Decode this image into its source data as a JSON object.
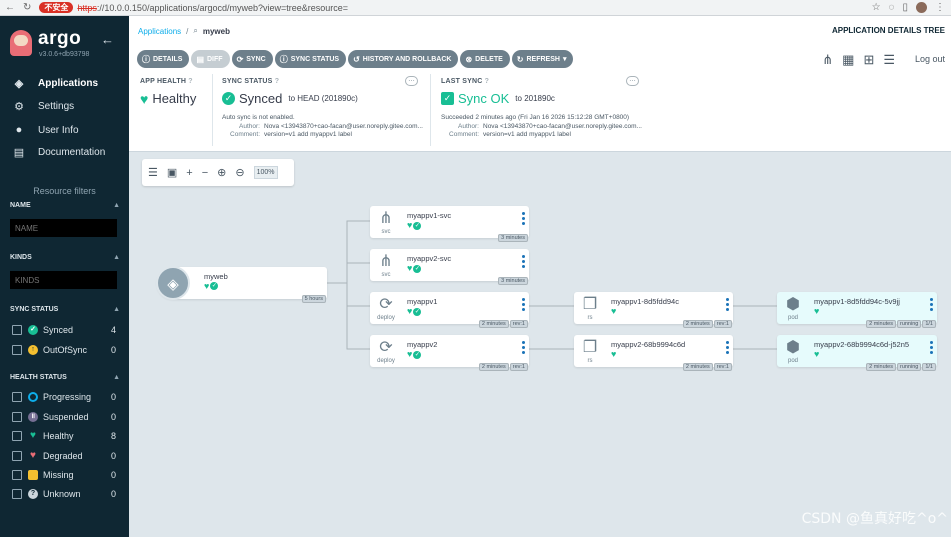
{
  "browser": {
    "insecure_label": "不安全",
    "url_proto": "https",
    "url_rest": "://10.0.0.150/applications/argocd/myweb?view=tree&resource="
  },
  "sidebar": {
    "logo_text": "argo",
    "version": "v3.0.6+db93798",
    "nav": [
      {
        "label": "Applications",
        "icon": "layers-icon"
      },
      {
        "label": "Settings",
        "icon": "gear-icon"
      },
      {
        "label": "User Info",
        "icon": "user-icon"
      },
      {
        "label": "Documentation",
        "icon": "docs-icon"
      }
    ],
    "filters_title": "Resource filters",
    "name_filter": {
      "title": "NAME",
      "placeholder": "NAME"
    },
    "kinds_filter": {
      "title": "KINDS",
      "placeholder": "KINDS"
    },
    "sync_status": {
      "title": "SYNC STATUS",
      "options": [
        {
          "label": "Synced",
          "count": "4",
          "color": "#18be94"
        },
        {
          "label": "OutOfSync",
          "count": "0",
          "color": "#f4c030"
        }
      ]
    },
    "health_status": {
      "title": "HEALTH STATUS",
      "options": [
        {
          "label": "Progressing",
          "count": "0",
          "color": "#0dadea"
        },
        {
          "label": "Suspended",
          "count": "0",
          "color": "#766f94"
        },
        {
          "label": "Healthy",
          "count": "8",
          "color": "#18be94"
        },
        {
          "label": "Degraded",
          "count": "0",
          "color": "#e96d76"
        },
        {
          "label": "Missing",
          "count": "0",
          "color": "#f4c030"
        },
        {
          "label": "Unknown",
          "count": "0",
          "color": "#ccd6dd"
        }
      ]
    }
  },
  "header": {
    "breadcrumb_root": "Applications",
    "breadcrumb_sep": "/",
    "breadcrumb_current": "myweb",
    "page_title": "APPLICATION DETAILS TREE",
    "logout": "Log out",
    "toolbar": [
      {
        "label": "DETAILS",
        "icon": "info-icon",
        "disabled": false
      },
      {
        "label": "DIFF",
        "icon": "diff-icon",
        "disabled": true
      },
      {
        "label": "SYNC",
        "icon": "sync-icon",
        "disabled": false
      },
      {
        "label": "SYNC STATUS",
        "icon": "info-icon",
        "disabled": false
      },
      {
        "label": "HISTORY AND ROLLBACK",
        "icon": "history-icon",
        "disabled": false
      },
      {
        "label": "DELETE",
        "icon": "delete-icon",
        "disabled": false
      },
      {
        "label": "REFRESH",
        "icon": "refresh-icon",
        "disabled": false
      }
    ]
  },
  "app_health": {
    "title": "APP HEALTH",
    "value": "Healthy"
  },
  "sync_status": {
    "title": "SYNC STATUS",
    "value": "Synced",
    "target": "to HEAD (201890c)",
    "note": "Auto sync is not enabled.",
    "author_key": "Author:",
    "author": "Nova <13943870+cao-facan@user.noreply.gitee.com...",
    "comment_key": "Comment:",
    "comment": "version=v1 add myappv1 label"
  },
  "last_sync": {
    "title": "LAST SYNC",
    "value": "Sync OK",
    "target": "to 201890c",
    "note": "Succeeded 2 minutes ago (Fri Jan 16 2026 15:12:28 GMT+0800)",
    "author_key": "Author:",
    "author": "Nova <13943870+cao-facan@user.noreply.gitee.com...",
    "comment_key": "Comment:",
    "comment": "version=v1 add myappv1 label"
  },
  "zoom": {
    "level": "100%"
  },
  "tree": {
    "app": {
      "name": "myweb",
      "age": "5 hours"
    },
    "nodes": [
      {
        "kind": "svc",
        "name": "myappv1-svc",
        "tags": [
          "3 minutes"
        ]
      },
      {
        "kind": "svc",
        "name": "myappv2-svc",
        "tags": [
          "3 minutes"
        ]
      },
      {
        "kind": "deploy",
        "name": "myappv1",
        "tags": [
          "2 minutes",
          "rev:1"
        ]
      },
      {
        "kind": "deploy",
        "name": "myappv2",
        "tags": [
          "2 minutes",
          "rev:1"
        ]
      },
      {
        "kind": "rs",
        "name": "myappv1-8d5fdd94c",
        "tags": [
          "2 minutes",
          "rev:1"
        ]
      },
      {
        "kind": "rs",
        "name": "myappv2-68b9994c6d",
        "tags": [
          "2 minutes",
          "rev:1"
        ]
      },
      {
        "kind": "pod",
        "name": "myappv1-8d5fdd94c-5v9jj",
        "tags": [
          "2 minutes",
          "running",
          "1/1"
        ]
      },
      {
        "kind": "pod",
        "name": "myappv2-68b9994c6d-j52n5",
        "tags": [
          "2 minutes",
          "running",
          "1/1"
        ]
      }
    ]
  },
  "watermark": "CSDN @鱼真好吃^o^"
}
